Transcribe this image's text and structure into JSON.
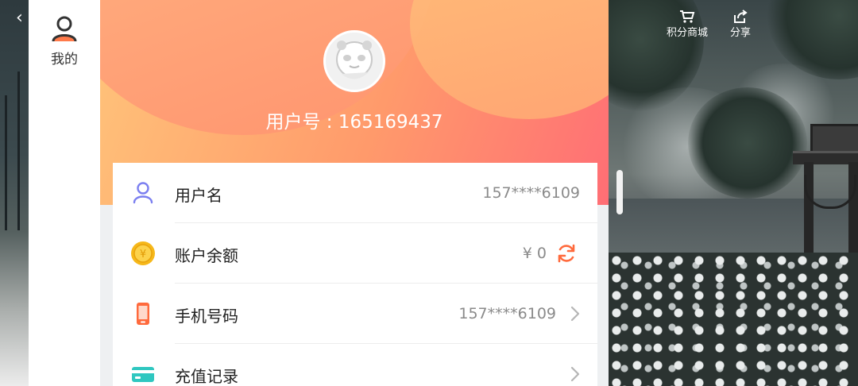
{
  "tab": {
    "label": "我的"
  },
  "top_actions": [
    {
      "label": "积分商城",
      "icon": "cart-icon"
    },
    {
      "label": "分享",
      "icon": "share-icon"
    }
  ],
  "profile": {
    "user_id_text": "用户号 : 165169437"
  },
  "rows": [
    {
      "label": "用户名",
      "value": "157****6109",
      "icon": "user-icon"
    },
    {
      "label": "账户余额",
      "value": "¥ 0",
      "icon": "coin-icon"
    },
    {
      "label": "手机号码",
      "value": "157****6109",
      "icon": "phone-icon"
    },
    {
      "label": "充值记录",
      "value": "",
      "icon": "card-icon"
    }
  ],
  "colors": {
    "accent": "#ff7a4a",
    "header_start": "#ffc47a",
    "header_end": "#ff6e75",
    "user_icon": "#7b7ff0",
    "coin": "#f6b81a",
    "phone": "#ff6a3d",
    "card_icon": "#2fc7c0"
  }
}
